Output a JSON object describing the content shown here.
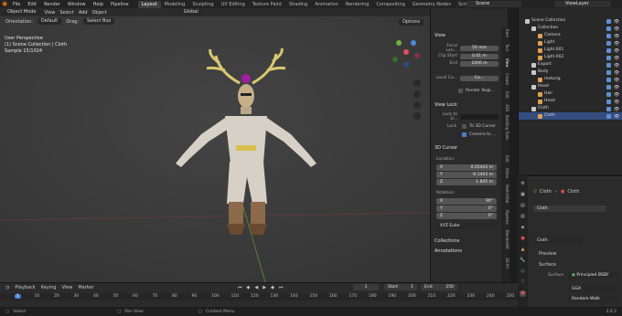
{
  "topbar": {
    "menus": [
      "File",
      "Edit",
      "Render",
      "Window",
      "Help",
      "Pipeline"
    ],
    "workspaces": [
      "Layout",
      "Modeling",
      "Sculpting",
      "UV Editing",
      "Texture Paint",
      "Shading",
      "Animation",
      "Rendering",
      "Compositing",
      "Geometry Nodes",
      "Scripting"
    ],
    "active_workspace": "Layout",
    "scene": "Scene",
    "view_layer": "ViewLayer"
  },
  "viewport": {
    "mode": "Object Mode",
    "menus": [
      "View",
      "Select",
      "Add",
      "Object"
    ],
    "orientation_label": "Orientation:",
    "orientation": "Default",
    "drag_label": "Drag:",
    "drag": "Select Box",
    "transform": "Global",
    "options": "Options",
    "info_line1": "User Perspective",
    "info_line2": "(1) Scene Collection | Cloth",
    "info_line3": "Sample 15/1024"
  },
  "npanel": {
    "view_header": "View",
    "focal_label": "Focal Len...",
    "focal_value": "50 mm",
    "clip_header": "Clip Start",
    "clip_start": "0.01 m",
    "end_label": "End",
    "end_value": "1000 m",
    "local_label": "Local Ca...",
    "local_cam": "Ca...",
    "render_region": "Render Regi...",
    "view_lock_header": "View Lock",
    "lock_to_label": "Lock to O...",
    "lock_label": "Lock",
    "to_cursor": "To 3D Cursor",
    "camera_to": "Camera to ...",
    "cursor_header": "3D Cursor",
    "location_label": "Location:",
    "loc_x_label": "X",
    "loc_x": "0.05443 m",
    "loc_y_label": "Y",
    "loc_y": "-0.1403 m",
    "loc_z_label": "Z",
    "loc_z": "1.845 m",
    "rotation_label": "Rotation:",
    "rot_x_label": "X",
    "rot_x": "90°",
    "rot_y_label": "Y",
    "rot_y": "0°",
    "rot_z_label": "Z",
    "rot_z": "0°",
    "rot_mode": "XYZ Euler",
    "collections_header": "Collections",
    "annotations_header": "Annotations",
    "tabs": [
      "Item",
      "Tool",
      "View",
      "Create",
      "Edit",
      "3DS",
      "Building Tools",
      "Edit",
      "Video",
      "SketchFab",
      "Pipeline",
      "BlenderKit",
      "3D-Pri"
    ]
  },
  "outliner": {
    "items": [
      {
        "label": "Scene Collection",
        "indent": 1,
        "color": "#c8c8c8",
        "selected": false
      },
      {
        "label": "Collection",
        "indent": 2,
        "color": "#c8c8c8",
        "selected": false
      },
      {
        "label": "Camera",
        "indent": 3,
        "color": "#e0a050",
        "selected": false
      },
      {
        "label": "Light",
        "indent": 3,
        "color": "#e0a050",
        "selected": false
      },
      {
        "label": "Light.001",
        "indent": 3,
        "color": "#e0a050",
        "selected": false
      },
      {
        "label": "Light.002",
        "indent": 3,
        "color": "#e0a050",
        "selected": false
      },
      {
        "label": "Export",
        "indent": 2,
        "color": "#c8c8c8",
        "selected": false
      },
      {
        "label": "Body",
        "indent": 2,
        "color": "#c8c8c8",
        "selected": false
      },
      {
        "label": "metarig",
        "indent": 3,
        "color": "#e0a050",
        "selected": false
      },
      {
        "label": "Head",
        "indent": 2,
        "color": "#c8c8c8",
        "selected": false
      },
      {
        "label": "Hair",
        "indent": 3,
        "color": "#e0a050",
        "selected": false
      },
      {
        "label": "Head",
        "indent": 3,
        "color": "#e0a050",
        "selected": false
      },
      {
        "label": "Cloth",
        "indent": 2,
        "color": "#c8c8c8",
        "selected": false
      },
      {
        "label": "Cloth",
        "indent": 3,
        "color": "#e0a050",
        "selected": true
      }
    ]
  },
  "properties": {
    "breadcrumb_obj": "Cloth",
    "breadcrumb_mat": "Cloth",
    "slot": "Cloth",
    "material": "Cloth",
    "preview": "Preview",
    "surface_header": "Surface",
    "surface_label": "Surface",
    "surface_value": "Principled BSDF",
    "dist": "GGX",
    "sss": "Random Walk"
  },
  "timeline": {
    "menus": [
      "Playback",
      "Keying",
      "View",
      "Marker"
    ],
    "current_frame": "1",
    "start_label": "Start",
    "start": "1",
    "end_label": "End",
    "end": "250",
    "ticks": [
      "1",
      "10",
      "20",
      "30",
      "40",
      "50",
      "60",
      "70",
      "80",
      "90",
      "100",
      "110",
      "120",
      "130",
      "140",
      "150",
      "160",
      "170",
      "180",
      "190",
      "200",
      "210",
      "220",
      "230",
      "240",
      "250"
    ]
  },
  "status": {
    "select": "Select",
    "pan": "Pan View",
    "context": "Context Menu",
    "version": "3.6.2"
  }
}
